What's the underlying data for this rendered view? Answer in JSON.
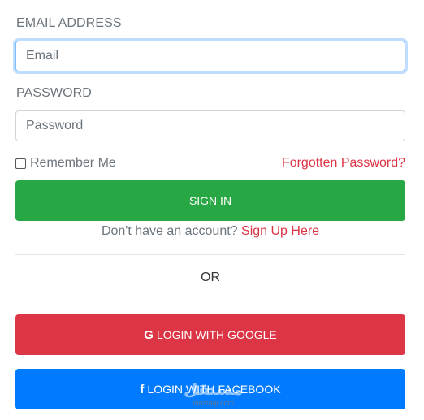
{
  "form": {
    "email_label": "EMAIL ADDRESS",
    "email_placeholder": "Email",
    "email_value": "",
    "password_label": "PASSWORD",
    "password_placeholder": "Password",
    "password_value": "",
    "remember_label": "Remember Me",
    "remember_checked": false,
    "forgot_link": "Forgotten Password?",
    "signin_button": "SIGN IN",
    "signup_prompt": "Don't have an account?",
    "signup_link": "Sign Up Here",
    "or_text": "OR",
    "google_icon": "G",
    "google_button": "LOGIN WITH GOOGLE",
    "facebook_icon": "f",
    "facebook_button": "LOGIN WITH FACEBOOK"
  },
  "watermark": {
    "main": "مستقل",
    "sub": "mostaql.com"
  },
  "colors": {
    "signin": "#28a745",
    "google": "#dc3545",
    "facebook": "#007bff",
    "link": "#dc3545",
    "focus_border": "#80bdff"
  }
}
